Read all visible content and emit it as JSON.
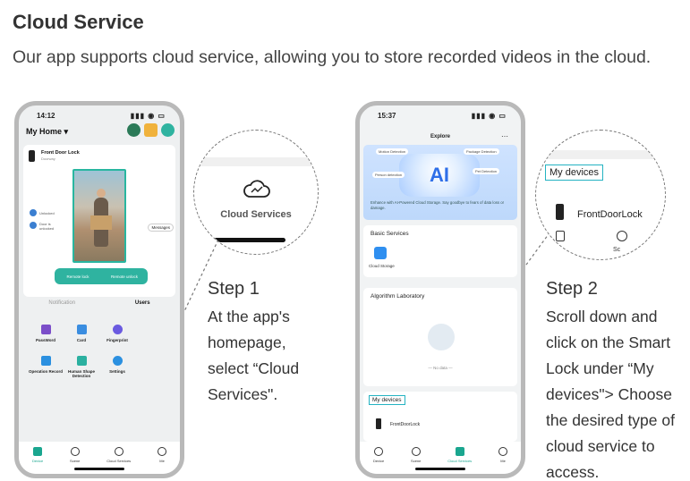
{
  "heading": {
    "title": "Cloud Service",
    "intro": "Our app supports cloud service, allowing you to store recorded videos in the cloud."
  },
  "phone1": {
    "time": "14:12",
    "home_title": "My Home ▾",
    "device_name": "Front Door Lock",
    "device_sub": "Doorway",
    "status_unlocked": "Unlocked",
    "status_door": "Door is unlocked",
    "messages": "Messages",
    "remote_lock": "Remote lock",
    "remote_unlock": "Remote unlock",
    "tab_notification": "Notification",
    "tab_users": "Users",
    "grid": [
      {
        "label": "PassWord",
        "color": "#7b4ec9",
        "icon": "password-icon"
      },
      {
        "label": "Card",
        "color": "#3a8de0",
        "icon": "card-icon"
      },
      {
        "label": "Fingerprint",
        "color": "#6a5ae0",
        "icon": "fingerprint-icon"
      },
      {
        "label": "",
        "color": "",
        "icon": ""
      },
      {
        "label": "Operation Record",
        "color": "#2b90e0",
        "icon": "record-icon"
      },
      {
        "label": "Human Shape Detection",
        "color": "#2bb0a0",
        "icon": "human-shape-icon"
      },
      {
        "label": "Settings",
        "color": "#2b90e0",
        "icon": "settings-icon"
      }
    ],
    "bottom_nav": [
      "Device",
      "Scene",
      "Cloud Services",
      "Me"
    ]
  },
  "callout1": {
    "label": "Cloud Services"
  },
  "step1": {
    "title": "Step 1",
    "body": "At the app's homepage, select “Cloud Services\"."
  },
  "phone2": {
    "time": "15:37",
    "title": "Explore",
    "chips": [
      "Motion Detection",
      "Package Detection",
      "Person detection",
      "Pet Detection"
    ],
    "enhance": "Enhance with AI-Powered Cloud Storage. Say goodbye to fears of data loss or damage.",
    "basic_services": "Basic Services",
    "cloud_storage": "Cloud Storage",
    "algorithm_lab": "Algorithm Laboratory",
    "no_data": "— No data —",
    "my_devices": "My devices",
    "device_name": "FrontDoorLock",
    "bottom_nav": [
      "Device",
      "Scene",
      "Cloud Services",
      "Me"
    ]
  },
  "callout2": {
    "my_devices": "My devices",
    "device_name": "FrontDoorLock",
    "partial_label": "Sc"
  },
  "step2": {
    "title": "Step 2",
    "body": "Scroll down and click on the Smart Lock under “My devices\"> Choose the desired type of cloud service to access."
  },
  "colors": {
    "accent": "#2fb3a0",
    "highlight_box": "#24b3c2",
    "cloud_blue": "#2f8ff0"
  }
}
